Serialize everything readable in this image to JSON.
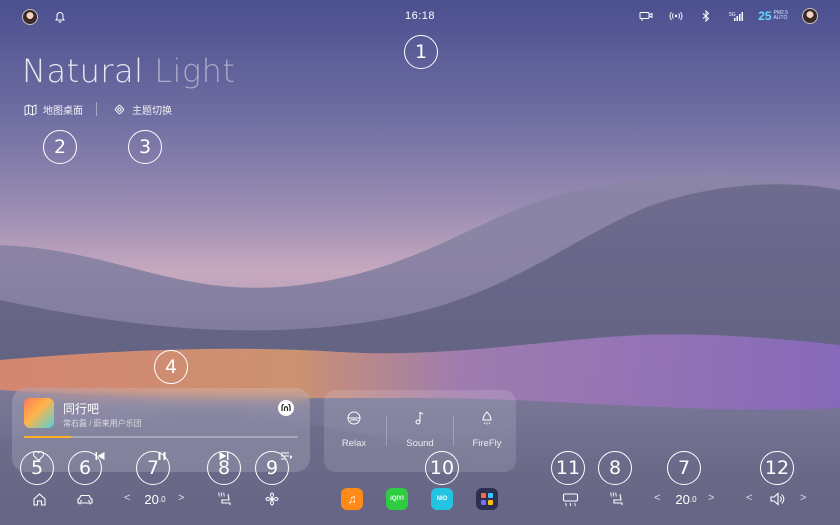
{
  "status_bar": {
    "time": "16:18",
    "outside_temp": "25",
    "temp_sub_top": "PM2.5",
    "temp_sub_bottom": "AUTO",
    "network": "5G"
  },
  "headline": {
    "main": "Natural ",
    "faint": "Light"
  },
  "shortcuts": [
    {
      "icon": "map-icon",
      "label": "地图桌面"
    },
    {
      "icon": "theme-icon",
      "label": "主题切换"
    }
  ],
  "music": {
    "title": "同行吧",
    "subtitle": "常石磊 / 蔚来用户乐团",
    "progress": 0.17
  },
  "modes": [
    {
      "icon": "relax-icon",
      "label": "Relax"
    },
    {
      "icon": "sound-icon",
      "label": "Sound"
    },
    {
      "icon": "firefly-icon",
      "label": "FireFly"
    }
  ],
  "climate": {
    "driver_temp": "20",
    "driver_temp_dec": ".0",
    "passenger_temp": "20",
    "passenger_temp_dec": ".0"
  },
  "apps": [
    {
      "name": "music-app",
      "label": "♫",
      "color": "#ff8a1a"
    },
    {
      "name": "iqiyi-app",
      "label": "iQIYI",
      "color": "#2ecc40"
    },
    {
      "name": "nio-app",
      "label": "NIO",
      "color": "#22c4e0"
    },
    {
      "name": "launcher-app",
      "label": "",
      "color": "#2b2f52"
    }
  ],
  "callouts": [
    "1",
    "2",
    "3",
    "4",
    "5",
    "6",
    "7",
    "8",
    "9",
    "10",
    "11",
    "8",
    "7",
    "12"
  ]
}
